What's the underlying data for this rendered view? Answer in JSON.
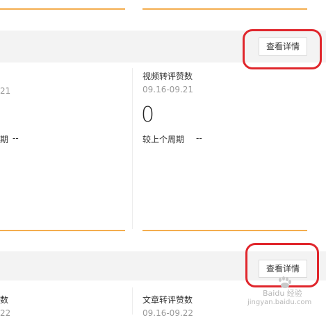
{
  "sections": [
    {
      "button_label": "查看详情"
    },
    {
      "button_label": "查看详情"
    }
  ],
  "top_card": {
    "left_cut_date": "21",
    "left_cut_prev": "期",
    "left_cut_dash": "--",
    "title": "视频转评赞数",
    "date_range": "09.16-09.21",
    "value": "0",
    "prev_label": "较上个周期",
    "prev_value": "--"
  },
  "bottom_card": {
    "left_cut_title": "数",
    "left_cut_date": "22",
    "title": "文章转评赞数",
    "date_range": "09.16-09.22"
  },
  "watermark": {
    "site": "jingyan.baidu.com",
    "brand": "Baidu 经验"
  }
}
